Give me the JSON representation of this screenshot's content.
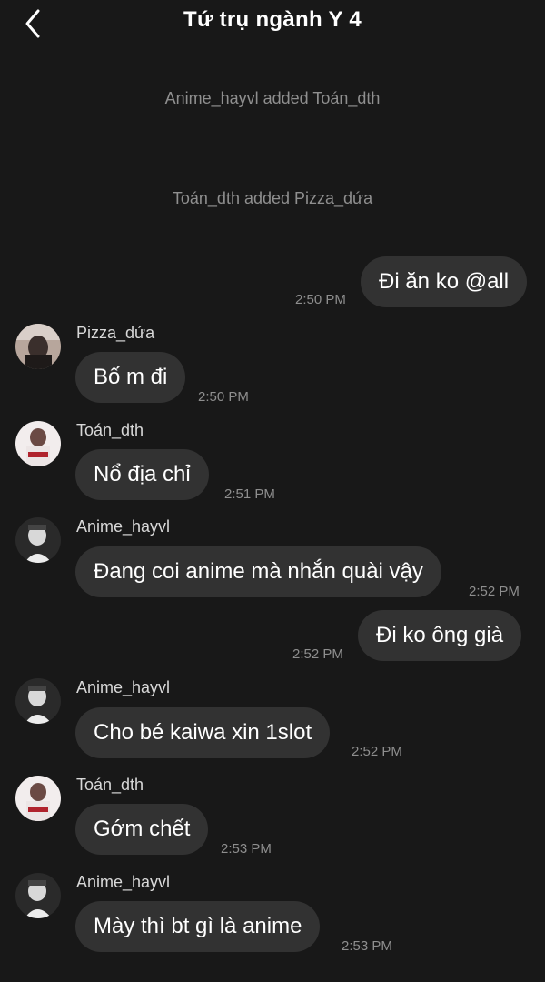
{
  "header": {
    "title": "Tứ trụ ngành Y 4",
    "back_icon": "chevron-left-icon"
  },
  "system_messages": [
    "Anime_hayvl added Toán_dth",
    "Toán_dth added Pizza_dứa"
  ],
  "messages": [
    {
      "side": "outgoing",
      "text": "Đi ăn ko @all",
      "time": "2:50 PM"
    },
    {
      "side": "incoming",
      "sender": "Pizza_dứa",
      "text": "Bố m đi",
      "time": "2:50 PM"
    },
    {
      "side": "incoming",
      "sender": "Toán_dth",
      "text": "Nổ địa chỉ",
      "time": "2:51 PM"
    },
    {
      "side": "incoming",
      "sender": "Anime_hayvl",
      "text": "Đang coi anime mà nhắn quài vậy",
      "time": "2:52 PM"
    },
    {
      "side": "outgoing",
      "text": "Đi ko ông già",
      "time": "2:52 PM"
    },
    {
      "side": "incoming",
      "sender": "Anime_hayvl",
      "text": "Cho bé kaiwa xin 1slot",
      "time": "2:52 PM"
    },
    {
      "side": "incoming",
      "sender": "Toán_dth",
      "text": "Gớm chết",
      "time": "2:53 PM"
    },
    {
      "side": "incoming",
      "sender": "Anime_hayvl",
      "text": "Mày thì bt gì là anime",
      "time": "2:53 PM"
    }
  ],
  "colors": {
    "background": "#181818",
    "bubble": "#323232",
    "timestamp": "#8e8e8e",
    "system_text": "#8f8f8f"
  }
}
